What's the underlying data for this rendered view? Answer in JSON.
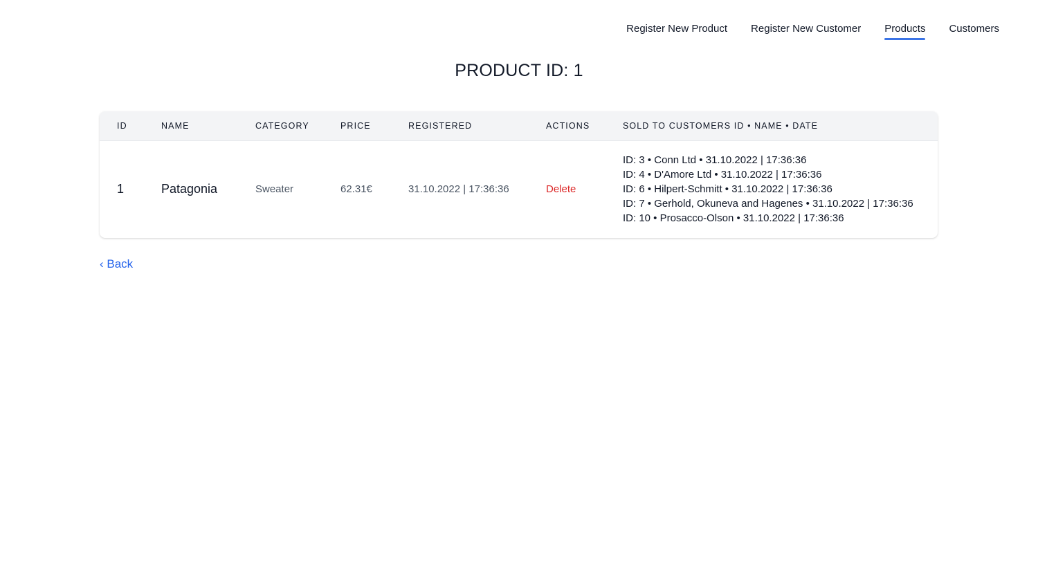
{
  "nav": {
    "items": [
      {
        "label": "Register New Product",
        "active": false
      },
      {
        "label": "Register New Customer",
        "active": false
      },
      {
        "label": "Products",
        "active": true
      },
      {
        "label": "Customers",
        "active": false
      }
    ],
    "accent_color": "#3b74e6"
  },
  "page": {
    "title": "PRODUCT ID: 1"
  },
  "table": {
    "headers": {
      "id": "ID",
      "name": "NAME",
      "category": "CATEGORY",
      "price": "PRICE",
      "registered": "REGISTERED",
      "actions": "ACTIONS",
      "sold": "SOLD TO CUSTOMERS ID • NAME • DATE"
    },
    "row": {
      "id": "1",
      "name": "Patagonia",
      "category": "Sweater",
      "price": "62.31€",
      "registered": "31.10.2022 | 17:36:36",
      "action_label": "Delete",
      "sold_to": [
        "ID: 3 • Conn Ltd • 31.10.2022 | 17:36:36",
        "ID: 4 • D'Amore Ltd • 31.10.2022 | 17:36:36",
        "ID: 6 • Hilpert-Schmitt • 31.10.2022 | 17:36:36",
        "ID: 7 • Gerhold, Okuneva and Hagenes • 31.10.2022 | 17:36:36",
        "ID: 10 • Prosacco-Olson • 31.10.2022 | 17:36:36"
      ]
    }
  },
  "back": {
    "label": "‹ Back"
  },
  "colors": {
    "delete": "#dc2626",
    "link": "#2563eb",
    "header_bg": "#f3f4f6"
  }
}
